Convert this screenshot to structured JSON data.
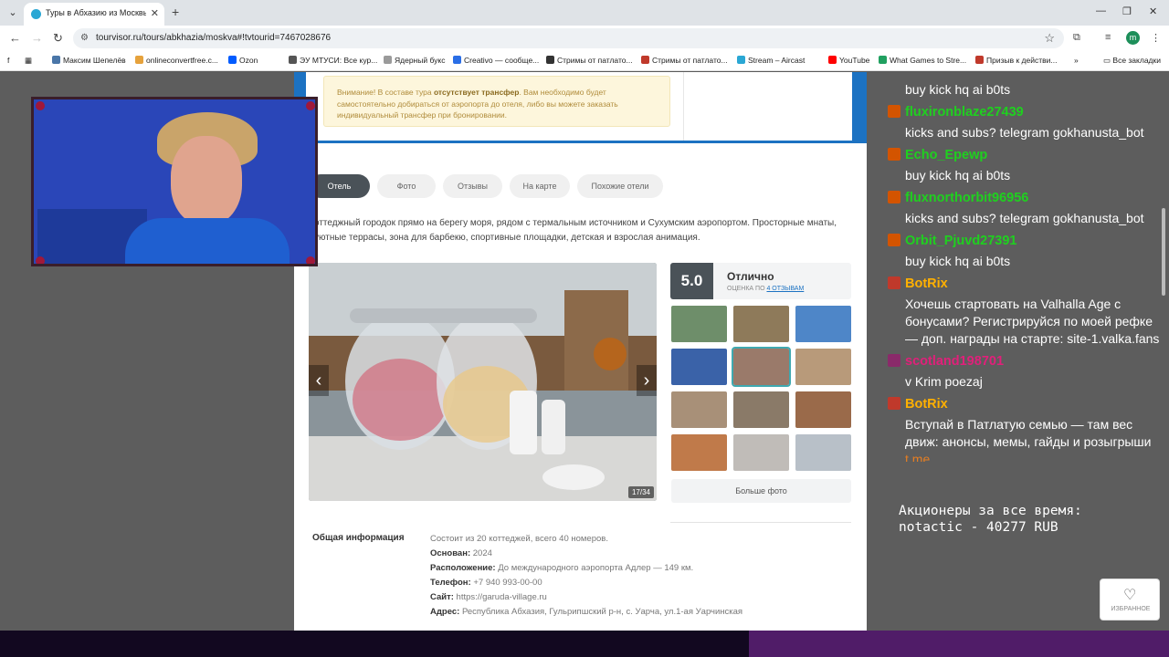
{
  "browser": {
    "tab_title": "Туры в Абхазию из Москвы 2...",
    "url": "tourvisor.ru/tours/abkhazia/moskva#!tvtourid=7467028676",
    "profile_letter": "m",
    "bookmarks": [
      {
        "label": "Максим Шепелёв",
        "color": "#4a76a8"
      },
      {
        "label": "onlineconvertfree.c...",
        "color": "#e6a23c"
      },
      {
        "label": "Ozon",
        "color": "#005bff"
      },
      {
        "label": "ЭУ МТУСИ: Все кур...",
        "color": "#555555"
      },
      {
        "label": "Ядерный букс",
        "color": "#9a9a9a"
      },
      {
        "label": "Creativo — сообще...",
        "color": "#2a6ee6"
      },
      {
        "label": "Стримы от патлато...",
        "color": "#333333"
      },
      {
        "label": "Стримы от патлато...",
        "color": "#c0392b"
      },
      {
        "label": "Stream – Aircast",
        "color": "#2aa7d4"
      },
      {
        "label": "YouTube",
        "color": "#ff0000"
      },
      {
        "label": "What Games to Stre...",
        "color": "#20a060"
      },
      {
        "label": "Призыв к действи...",
        "color": "#c0392b"
      }
    ],
    "all_bookmarks": "Все закладки"
  },
  "page": {
    "warning_prefix": "Внимание! В составе тура ",
    "warning_bold": "отсутствует трансфер",
    "warning_rest": ". Вам необходимо будет самостоятельно добираться от аэропорта до отеля, либо вы можете заказать индивидуальный трансфер при бронировании.",
    "tabs": [
      "Отель",
      "Фото",
      "Отзывы",
      "На карте",
      "Похожие отели"
    ],
    "description": "оттеджный городок прямо на берегу моря, рядом с термальным источником и Сухумским аэропортом. Просторные мнаты, уютные террасы, зона для барбекю, спортивные площадки, детская и взрослая анимация.",
    "gallery_counter": "17/34",
    "rating_score": "5.0",
    "rating_word": "Отлично",
    "rating_sub": "ОЦЕНКА ПО ",
    "rating_link": "4 ОТЗЫВАМ",
    "more_photos": "Больше фото",
    "info_title": "Общая информация",
    "info": {
      "line1": "Состоит из 20 коттеджей, всего 40 номеров.",
      "founded_label": "Основан:",
      "founded": " 2024",
      "location_label": "Расположение:",
      "location": " До международного аэропорта Адлер — 149 км.",
      "phone_label": "Телефон:",
      "phone": " +7 940 993-00-00",
      "site_label": "Сайт:",
      "site": " https://garuda-village.ru",
      "address_label": "Адрес:",
      "address": " Республика Абхазия, Гульрипшский р-н, с. Уарча, ул.1-ая Уарчинская"
    },
    "favorite": "ИЗБРАННОЕ"
  },
  "chat": [
    {
      "user": "",
      "msg": "buy kick hq ai b0ts",
      "color": "#ffffff"
    },
    {
      "user": "fluxironblaze27439",
      "msg": "",
      "color": "#1fd01f"
    },
    {
      "user": "",
      "msg": "kicks and subs? telegram gokhanusta_bot",
      "color": "#ffffff"
    },
    {
      "user": "Echo_Epewp",
      "msg": "",
      "color": "#1fd01f"
    },
    {
      "user": "",
      "msg": "buy kick hq ai b0ts",
      "color": "#ffffff"
    },
    {
      "user": "fluxnorthorbit96956",
      "msg": "",
      "color": "#1fd01f"
    },
    {
      "user": "",
      "msg": "kicks and subs? telegram gokhanusta_bot",
      "color": "#ffffff"
    },
    {
      "user": "Orbit_Pjuvd27391",
      "msg": "",
      "color": "#1fd01f"
    },
    {
      "user": "",
      "msg": "buy kick hq ai b0ts",
      "color": "#ffffff"
    },
    {
      "user": "BotRix",
      "msg": "",
      "color": "#ffb000"
    },
    {
      "user": "",
      "msg": "Хочешь стартовать на Valhalla Age с",
      "color": "#ffffff"
    },
    {
      "user": "",
      "msg": "бонусами? Регистрируйся по моей рефке",
      "color": "#ffffff"
    },
    {
      "user": "",
      "msg": "— доп. награды на старте: site-1.valka.fans",
      "color": "#ffffff"
    },
    {
      "user": "scotland198701",
      "msg": "",
      "color": "#e0207a"
    },
    {
      "user": "",
      "msg": "v Krim poezaj",
      "color": "#ffffff"
    },
    {
      "user": "BotRix",
      "msg": "",
      "color": "#ffb000"
    },
    {
      "user": "",
      "msg": "Вступай в Патлатую семью — там вес",
      "color": "#ffffff"
    },
    {
      "user": "",
      "msg": "движ: анонсы, мемы, гайды и розыгрыши",
      "color": "#ffffff"
    },
    {
      "user": "",
      "msg": "t.me",
      "color": "#e67e22"
    }
  ],
  "stats": {
    "line1": "Акционеры за все время:",
    "line2": "notactic - 40277 RUB"
  }
}
